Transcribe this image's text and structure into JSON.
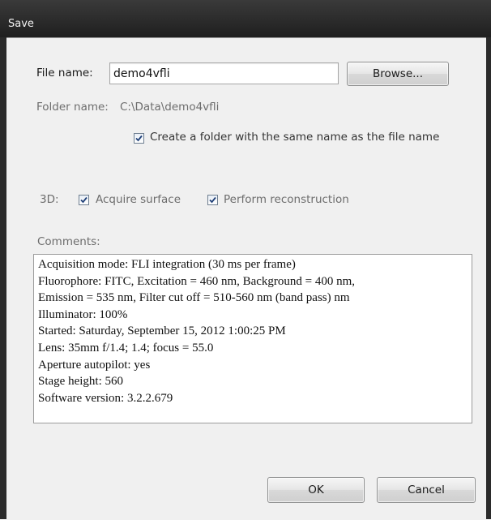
{
  "window": {
    "title": "Save"
  },
  "file": {
    "label": "File name:",
    "value": "demo4vfli",
    "browse_label": "Browse..."
  },
  "folder": {
    "label": "Folder name:",
    "value": "C:\\Data\\demo4vfli",
    "create_folder_label": "Create a folder with the same name as the file name",
    "create_folder_checked": true
  },
  "three_d": {
    "label": "3D:",
    "acquire_surface_label": "Acquire surface",
    "acquire_surface_checked": true,
    "perform_reconstruction_label": "Perform reconstruction",
    "perform_reconstruction_checked": true
  },
  "comments": {
    "label": "Comments:",
    "lines": [
      "Acquisition mode: FLI integration (30 ms per frame)",
      "Fluorophore: FITC, Excitation = 460 nm, Background = 400 nm,",
      "Emission = 535 nm, Filter cut off = 510-560 nm (band pass) nm",
      "Illuminator: 100%",
      "Started: Saturday, September 15, 2012 1:00:25 PM",
      "Lens: 35mm f/1.4; 1.4; focus = 55.0",
      "Aperture autopilot: yes",
      "Stage height: 560",
      "Software version: 3.2.2.679"
    ]
  },
  "buttons": {
    "ok_label": "OK",
    "cancel_label": "Cancel"
  }
}
